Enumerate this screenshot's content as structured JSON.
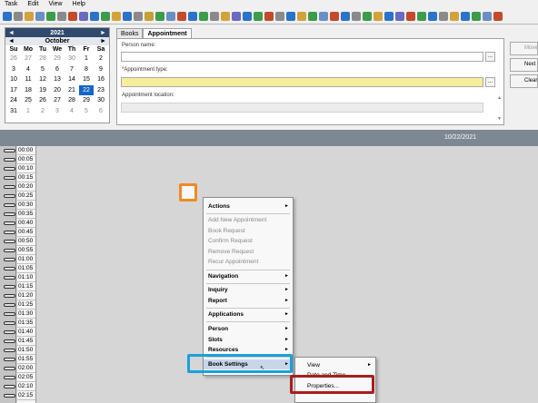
{
  "menubar": [
    "Task",
    "Edit",
    "View",
    "Help"
  ],
  "toolbar_colors": [
    "#2a73c9",
    "#8a8a8a",
    "#d4a23a",
    "#6a8fc4",
    "#3c9c4a",
    "#8a8a8a",
    "#c44a2a",
    "#6a6ac4",
    "#2a73c9",
    "#3c9c4a",
    "#d4a23a",
    "#2a73c9",
    "#8a8a8a",
    "#c4a03a",
    "#3c9c4a",
    "#6a8fc4",
    "#c44a2a",
    "#2a73c9",
    "#3c9c4a",
    "#8a8a8a",
    "#d4a23a",
    "#6a6ac4",
    "#2a73c9",
    "#3c9c4a",
    "#c44a2a",
    "#8a8a8a",
    "#2a73c9",
    "#d4a23a",
    "#3c9c4a",
    "#6a8fc4",
    "#c44a2a",
    "#2a73c9",
    "#8a8a8a",
    "#3c9c4a",
    "#d4a23a",
    "#2a73c9",
    "#6a6ac4",
    "#c44a2a",
    "#3c9c4a",
    "#2a73c9",
    "#8a8a8a",
    "#d4a23a",
    "#2a73c9",
    "#3c9c4a",
    "#6a8fc4",
    "#c44a2a"
  ],
  "calendar": {
    "year": "2021",
    "month": "October",
    "nav_prev": "◄",
    "nav_next": "►",
    "weekdays": [
      "Su",
      "Mo",
      "Tu",
      "We",
      "Th",
      "Fr",
      "Sa"
    ],
    "weeks": [
      [
        {
          "d": "26",
          "o": true
        },
        {
          "d": "27",
          "o": true
        },
        {
          "d": "28",
          "o": true
        },
        {
          "d": "29",
          "o": true
        },
        {
          "d": "30",
          "o": true
        },
        {
          "d": "1"
        },
        {
          "d": "2"
        }
      ],
      [
        {
          "d": "3"
        },
        {
          "d": "4"
        },
        {
          "d": "5"
        },
        {
          "d": "6"
        },
        {
          "d": "7"
        },
        {
          "d": "8"
        },
        {
          "d": "9"
        }
      ],
      [
        {
          "d": "10"
        },
        {
          "d": "11"
        },
        {
          "d": "12"
        },
        {
          "d": "13"
        },
        {
          "d": "14"
        },
        {
          "d": "15"
        },
        {
          "d": "16"
        }
      ],
      [
        {
          "d": "17"
        },
        {
          "d": "18"
        },
        {
          "d": "19"
        },
        {
          "d": "20"
        },
        {
          "d": "21"
        },
        {
          "d": "22",
          "sel": true
        },
        {
          "d": "23"
        }
      ],
      [
        {
          "d": "24"
        },
        {
          "d": "25"
        },
        {
          "d": "26"
        },
        {
          "d": "27"
        },
        {
          "d": "28"
        },
        {
          "d": "29"
        },
        {
          "d": "30"
        }
      ],
      [
        {
          "d": "31"
        },
        {
          "d": "1",
          "o": true
        },
        {
          "d": "2",
          "o": true
        },
        {
          "d": "3",
          "o": true
        },
        {
          "d": "4",
          "o": true
        },
        {
          "d": "5",
          "o": true
        },
        {
          "d": "6",
          "o": true
        }
      ]
    ]
  },
  "tabs": [
    "Books",
    "Appointment"
  ],
  "form": {
    "person_label": "Person name:",
    "type_label": "Appointment type:",
    "type_required": "*",
    "location_label": "Appointment location:",
    "browse": "...",
    "scroll_up": "▲",
    "scroll_down": "▼"
  },
  "side_buttons": {
    "move": "Move",
    "next": "Next",
    "clear": "Clear"
  },
  "banner_date": "10/22/2021",
  "time_slots": [
    "00:00",
    "00:05",
    "00:10",
    "00:15",
    "00:20",
    "00:25",
    "00:30",
    "00:35",
    "00:40",
    "00:45",
    "00:50",
    "00:55",
    "01:00",
    "01:05",
    "01:10",
    "01:15",
    "01:20",
    "01:25",
    "01:30",
    "01:35",
    "01:40",
    "01:45",
    "01:50",
    "01:55",
    "02:00",
    "02:05",
    "02:10",
    "02:15"
  ],
  "context_menu": {
    "actions": "Actions",
    "add_new": "Add New Appointment",
    "book_request": "Book Request",
    "confirm_request": "Confirm Request",
    "remove_request": "Remove Request",
    "recur": "Recur Appointment",
    "navigation": "Navigation",
    "inquiry": "Inquiry",
    "report": "Report",
    "applications": "Applications",
    "person": "Person",
    "slots": "Slots",
    "resources": "Resources",
    "book_settings": "Book Settings",
    "arrow": "►"
  },
  "submenu": {
    "view": "View",
    "date_time": "Date and Time",
    "properties": "Properties..."
  }
}
